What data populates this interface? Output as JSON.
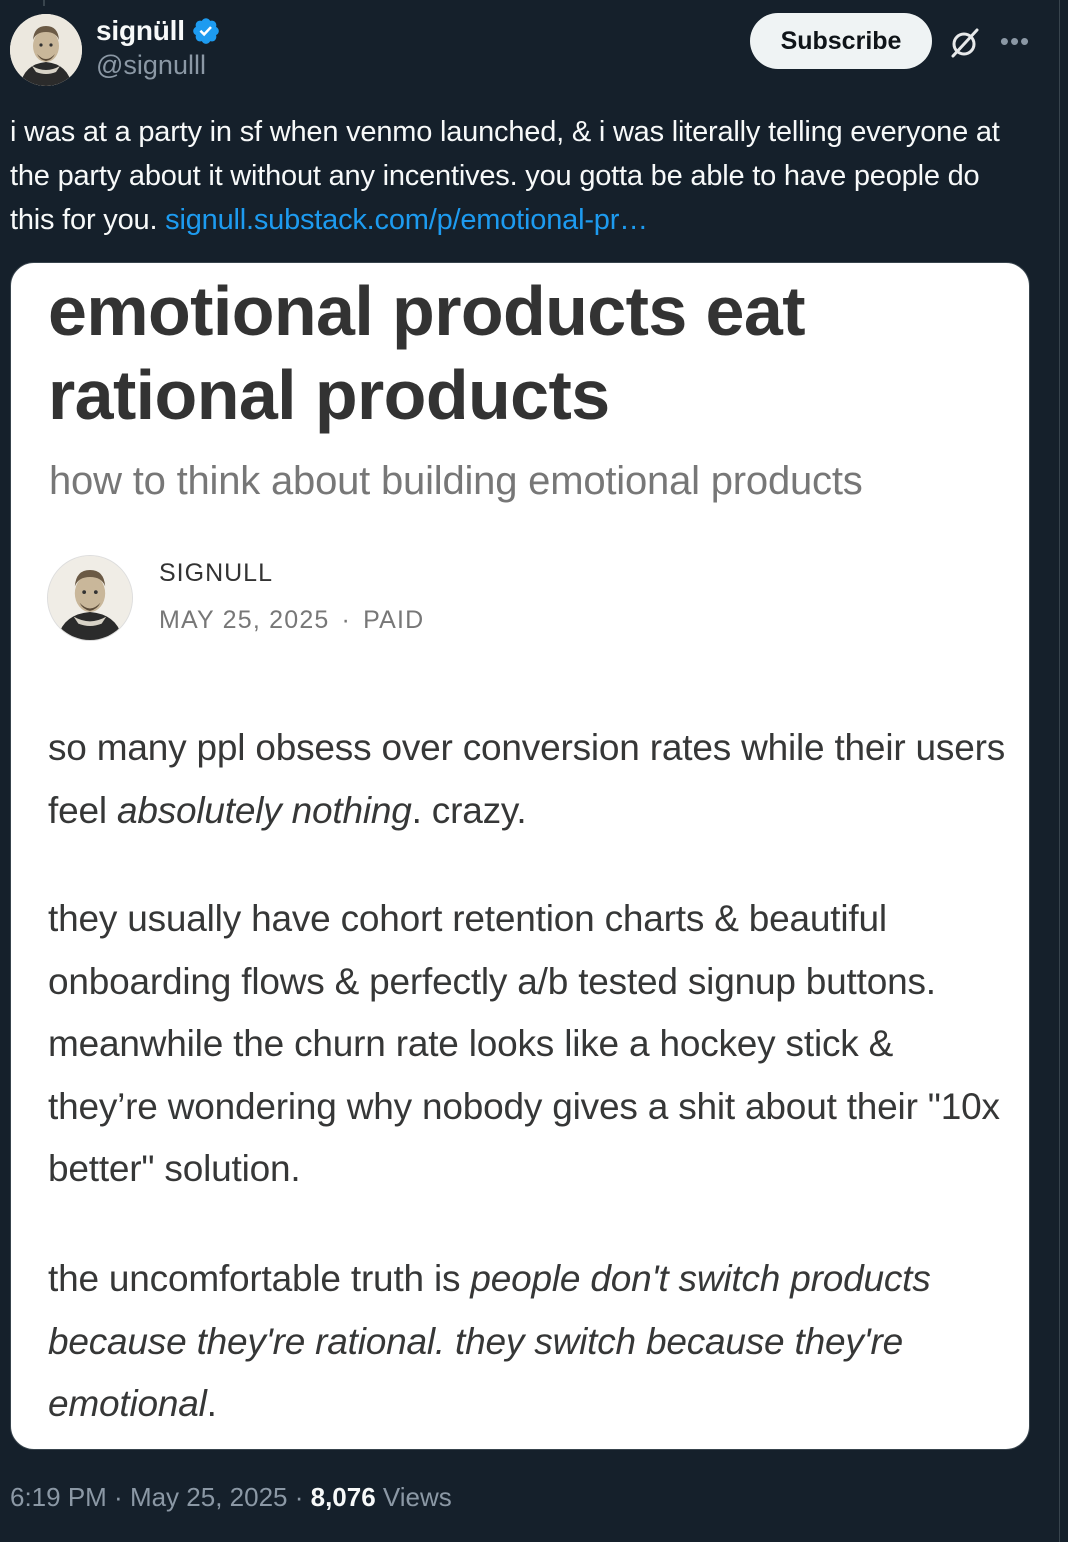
{
  "author": {
    "display_name": "signüll",
    "handle": "@signulll",
    "verified": true
  },
  "actions": {
    "subscribe_label": "Subscribe",
    "grok_icon": "grok-icon",
    "more_icon": "more-icon"
  },
  "tweet": {
    "text": "i was at a party in sf when venmo launched, & i was literally telling everyone at the party about it without any incentives. you gotta be able to have people do this for you. ",
    "link_text": "signull.substack.com/p/emotional-pr…"
  },
  "article": {
    "title": "emotional products eat rational products",
    "subtitle": "how to think about building emotional products",
    "author_name": "SIGNULL",
    "date": "MAY 25, 2025",
    "separator": "·",
    "access": "PAID",
    "p1_a": "so many ppl obsess over conversion rates while their users feel ",
    "p1_em": "absolutely nothing",
    "p1_b": ". crazy.",
    "p2": "they usually have cohort retention charts & beautiful onboarding flows & perfectly a/b tested signup buttons. meanwhile the churn rate looks like a hockey stick & they’re wondering why nobody gives a shit about their \"10x better\" solution.",
    "p3_a": "the uncomfortable truth is ",
    "p3_em": "people don't switch products because they're rational. they switch because they're emotional",
    "p3_b": "."
  },
  "footer": {
    "time": "6:19 PM",
    "dot1": " · ",
    "date": "May 25, 2025",
    "dot2": " · ",
    "views_count": "8,076",
    "views_label": " Views"
  },
  "colors": {
    "background": "#15202b",
    "link": "#1d9bf0",
    "verified": "#1d9bf0",
    "muted": "#8b98a5"
  }
}
